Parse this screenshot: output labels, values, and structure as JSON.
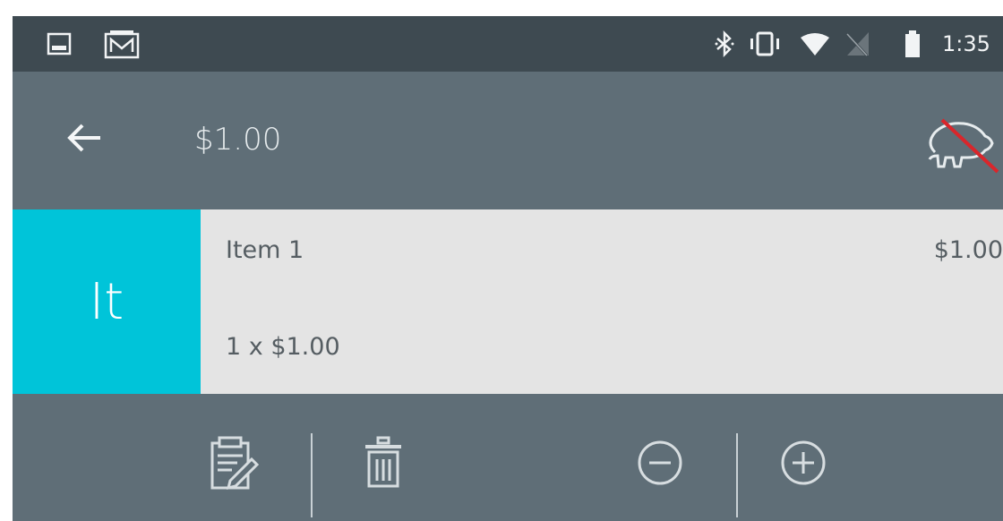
{
  "status_bar": {
    "time": "1:35",
    "notification_icons": [
      "image-icon",
      "gmail-icon"
    ],
    "system_icons": [
      "bluetooth-icon",
      "vibrate-icon",
      "wifi-icon",
      "no-signal-icon",
      "battery-icon"
    ]
  },
  "toolbar": {
    "title": "$1.00",
    "back_icon": "arrow-left-icon",
    "action_icon": "piggy-bank-crossed-icon"
  },
  "item": {
    "avatar_text": "It",
    "avatar_color": "#00c4d9",
    "name": "Item 1",
    "price": "$1.00",
    "quantity_line": "1 x $1.00"
  },
  "actions": [
    "edit-note-icon",
    "trash-icon",
    "minus-circle-icon",
    "plus-circle-icon"
  ],
  "colors": {
    "status_bar": "#3e4a51",
    "toolbar": "#5f6e77",
    "row_background": "#e4e4e4",
    "accent": "#00c4d9",
    "strike": "#d9262b"
  }
}
